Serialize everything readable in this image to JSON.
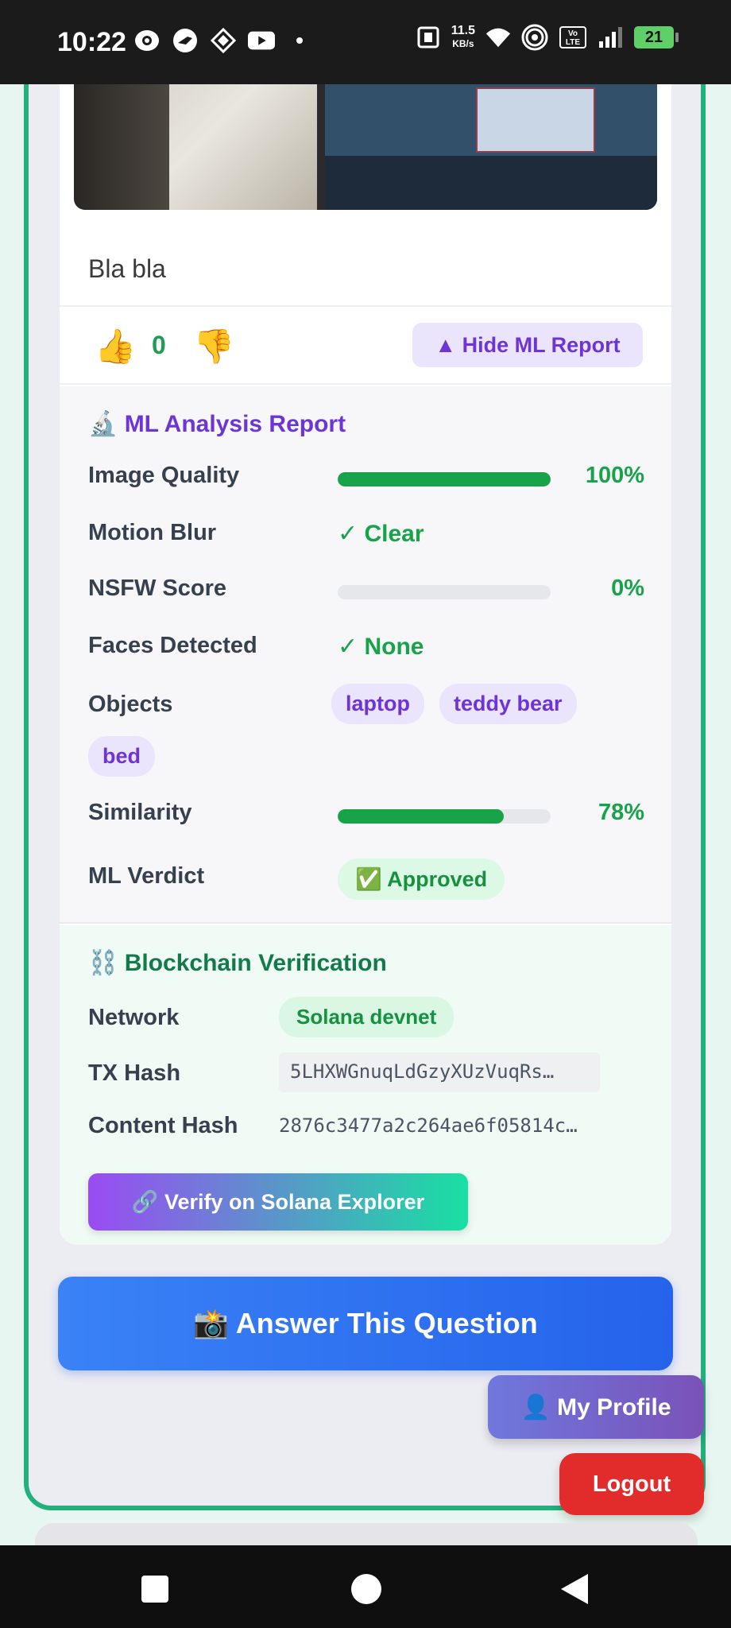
{
  "status_bar": {
    "time": "10:22",
    "net_speed_value": "11.5",
    "net_speed_unit": "KB/s",
    "volte": "Vo LTE",
    "battery": "21"
  },
  "post": {
    "caption": "Bla bla",
    "vote_count": "0",
    "thumbs_up": "👍",
    "thumbs_down": "👎",
    "toggle_ml_label": "▲ Hide ML Report"
  },
  "ml_report": {
    "title": "🔬 ML Analysis Report",
    "image_quality": {
      "label": "Image Quality",
      "value": "100%",
      "fraction": 1.0
    },
    "motion_blur": {
      "label": "Motion Blur",
      "value": "✓ Clear"
    },
    "nsfw_score": {
      "label": "NSFW Score",
      "value": "0%",
      "fraction": 0.0
    },
    "faces_detected": {
      "label": "Faces Detected",
      "value": "✓ None"
    },
    "objects": {
      "label": "Objects",
      "items": [
        "laptop",
        "teddy bear",
        "bed"
      ]
    },
    "similarity": {
      "label": "Similarity",
      "value": "78%",
      "fraction": 0.78
    },
    "verdict": {
      "label": "ML Verdict",
      "value": "✅ Approved"
    }
  },
  "blockchain": {
    "title": "⛓️ Blockchain Verification",
    "network": {
      "label": "Network",
      "value": "Solana devnet"
    },
    "tx_hash": {
      "label": "TX Hash",
      "value": "5LHXWGnuqLdGzyXUzVuqRs…"
    },
    "content_hash": {
      "label": "Content Hash",
      "value": "2876c3477a2c264ae6f05814c…"
    },
    "verify_label": "🔗 Verify on Solana Explorer"
  },
  "actions": {
    "answer_label": "📸 Answer This Question",
    "profile_label": "👤 My Profile",
    "logout_label": "Logout"
  },
  "colors": {
    "accent_green": "#18a34a",
    "accent_purple": "#6d35d6",
    "frame_border": "#22b07d",
    "answer_blue": "#2563eb",
    "logout_red": "#e22b2b"
  }
}
